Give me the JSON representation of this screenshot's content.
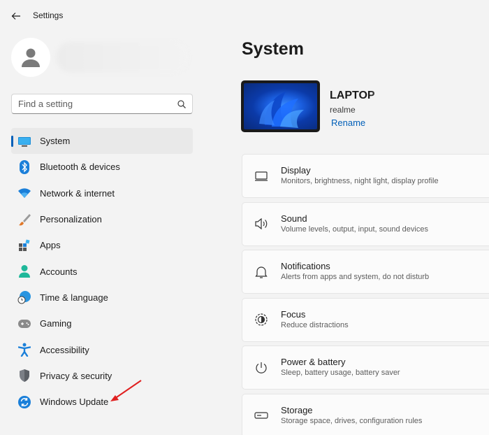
{
  "window": {
    "title": "Settings"
  },
  "search": {
    "placeholder": "Find a setting"
  },
  "sidebar": {
    "items": [
      {
        "label": "System",
        "icon": "monitor-icon",
        "selected": true
      },
      {
        "label": "Bluetooth & devices",
        "icon": "bluetooth-icon"
      },
      {
        "label": "Network & internet",
        "icon": "wifi-icon"
      },
      {
        "label": "Personalization",
        "icon": "brush-icon"
      },
      {
        "label": "Apps",
        "icon": "apps-icon"
      },
      {
        "label": "Accounts",
        "icon": "person-icon"
      },
      {
        "label": "Time & language",
        "icon": "globe-clock-icon"
      },
      {
        "label": "Gaming",
        "icon": "gamepad-icon"
      },
      {
        "label": "Accessibility",
        "icon": "accessibility-icon"
      },
      {
        "label": "Privacy & security",
        "icon": "shield-icon"
      },
      {
        "label": "Windows Update",
        "icon": "sync-icon"
      }
    ]
  },
  "main": {
    "title": "System",
    "device": {
      "name": "LAPTOP",
      "model": "realme",
      "rename": "Rename"
    },
    "cards": [
      {
        "title": "Display",
        "subtitle": "Monitors, brightness, night light, display profile",
        "icon": "display-icon"
      },
      {
        "title": "Sound",
        "subtitle": "Volume levels, output, input, sound devices",
        "icon": "speaker-icon"
      },
      {
        "title": "Notifications",
        "subtitle": "Alerts from apps and system, do not disturb",
        "icon": "bell-icon"
      },
      {
        "title": "Focus",
        "subtitle": "Reduce distractions",
        "icon": "focus-icon"
      },
      {
        "title": "Power & battery",
        "subtitle": "Sleep, battery usage, battery saver",
        "icon": "power-icon"
      },
      {
        "title": "Storage",
        "subtitle": "Storage space, drives, configuration rules",
        "icon": "storage-icon"
      }
    ]
  },
  "colors": {
    "accent": "#005fb8",
    "annotation_arrow": "#e02020"
  }
}
